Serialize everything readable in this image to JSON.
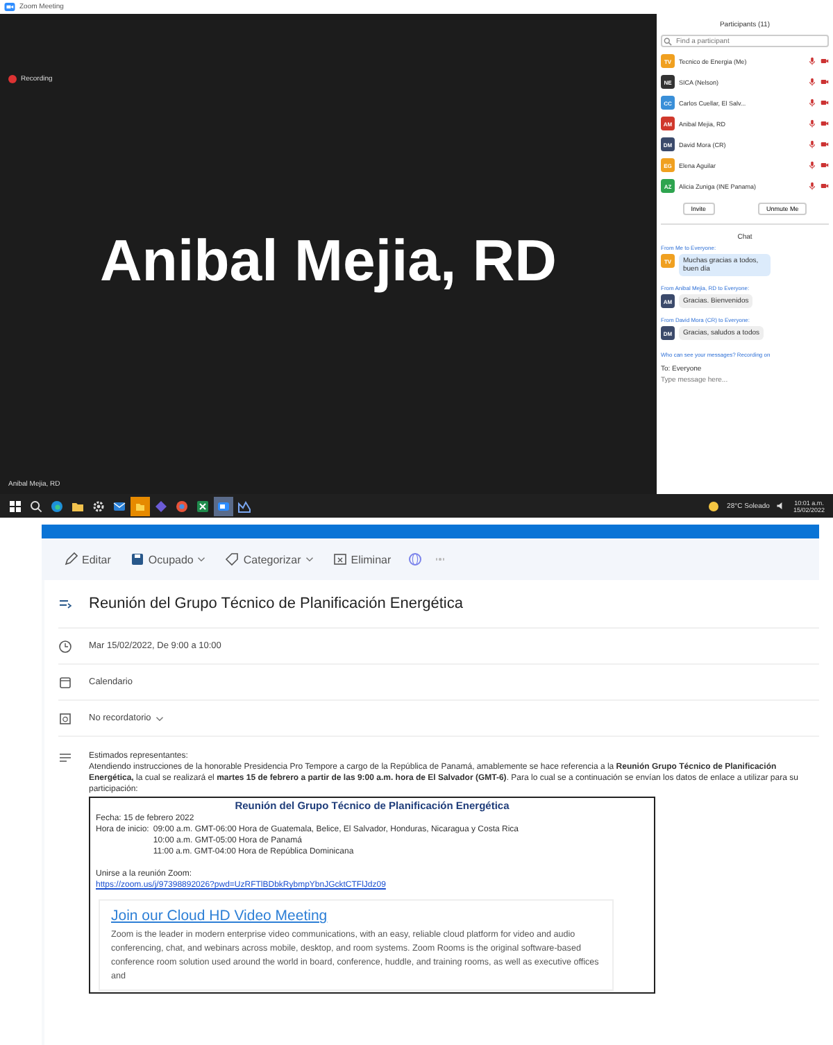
{
  "zoom_window": {
    "title": "Zoom Meeting",
    "recording": "Recording",
    "speaker_name": "Anibal Mejia, RD",
    "name_label": "Anibal Mejia, RD"
  },
  "participants": {
    "title": "Participants (11)",
    "search": {
      "placeholder": "Find a participant"
    },
    "items": [
      {
        "initials": "TV",
        "name": "Tecnico de Energia (Me)",
        "color": "#f0a020"
      },
      {
        "initials": "NE",
        "name": "SICA (Nelson)",
        "color": "#333333"
      },
      {
        "initials": "CC",
        "name": "Carlos Cuellar, El Salv...",
        "color": "#3a8fd8"
      },
      {
        "initials": "AM",
        "name": "Anibal Mejia, RD",
        "color": "#d0382c"
      },
      {
        "initials": "DM",
        "name": "David Mora (CR)",
        "color": "#3b4a6b"
      },
      {
        "initials": "EG",
        "name": "Elena Aguilar",
        "color": "#f0a020"
      },
      {
        "initials": "AZ",
        "name": "Alicia Zuniga (INE Panama)",
        "color": "#2ea44f"
      }
    ],
    "buttons": [
      "Invite",
      "Unmute Me"
    ]
  },
  "chat": {
    "title": "Chat",
    "messages": [
      {
        "sender": "From Me to Everyone:",
        "initials": "TV",
        "color": "#f0a020",
        "text": "Muchas gracias a todos, buen día",
        "mine": true
      },
      {
        "sender": "From Anibal Mejia, RD to Everyone:",
        "initials": "AM",
        "color": "#3b4a6b",
        "text": "Gracias. Bienvenidos",
        "mine": false
      },
      {
        "sender": "From David Mora (CR) to Everyone:",
        "initials": "DM",
        "color": "#3b4a6b",
        "text": "Gracias, saludos a todos",
        "mine": false
      }
    ],
    "notice": "Who can see your messages? Recording on",
    "to": "To: Everyone",
    "placeholder": "Type message here..."
  },
  "taskbar": {
    "weather": "28°C Soleado",
    "time": "10:01 a.m.",
    "date": "15/02/2022"
  },
  "event": {
    "toolbar": [
      {
        "label": "Editar",
        "kind": "edit",
        "dropdown": false
      },
      {
        "label": "Ocupado",
        "kind": "busy",
        "dropdown": true
      },
      {
        "label": "Categorizar",
        "kind": "tag",
        "dropdown": true
      },
      {
        "label": "Eliminar",
        "kind": "delete",
        "dropdown": false
      }
    ],
    "title": "Reunión del Grupo Técnico de Planificación Energética",
    "when": "Mar 15/02/2022, De 9:00 a 10:00",
    "calendar": "Calendario",
    "reminder": "No recordatorio",
    "greeting": "Estimados representantes:",
    "intro": "Atendiendo instrucciones de la honorable Presidencia Pro Tempore a cargo de la República de Panamá, amablemente se hace referencia a la **Reunión Grupo Técnico de Planificación Energética,** la cual se realizará el **martes 15 de febrero a partir de las 9:00 a.m. hora de El Salvador (GMT-6)**. Para lo cual se a continuación se envían los datos de enlace a utilizar para su participación:",
    "box": {
      "title": "Reunión del Grupo Técnico de Planificación Energética",
      "date": "Fecha: 15 de febrero 2022",
      "start_label": "Hora de inicio:",
      "times": [
        "09:00 a.m. GMT-06:00 Hora de Guatemala, Belice, El Salvador, Honduras, Nicaragua y Costa Rica",
        "10:00 a.m. GMT-05:00 Hora de Panamá",
        "11:00 a.m. GMT-04:00 Hora de República Dominicana"
      ],
      "join": "Unirse a la reunión Zoom:",
      "link": "https://zoom.us/j/97398892026?pwd=UzRFTlBDbkRybmpYbnJGcktCTFlJdz09",
      "card_title": "Join our Cloud HD Video Meeting",
      "card_text": "Zoom is the leader in modern enterprise video communications, with an easy, reliable cloud platform for video and audio conferencing, chat, and webinars across mobile, desktop, and room systems. Zoom Rooms is the original software-based conference room solution used around the world in board, conference, huddle, and training rooms, as well as executive offices and"
    }
  }
}
